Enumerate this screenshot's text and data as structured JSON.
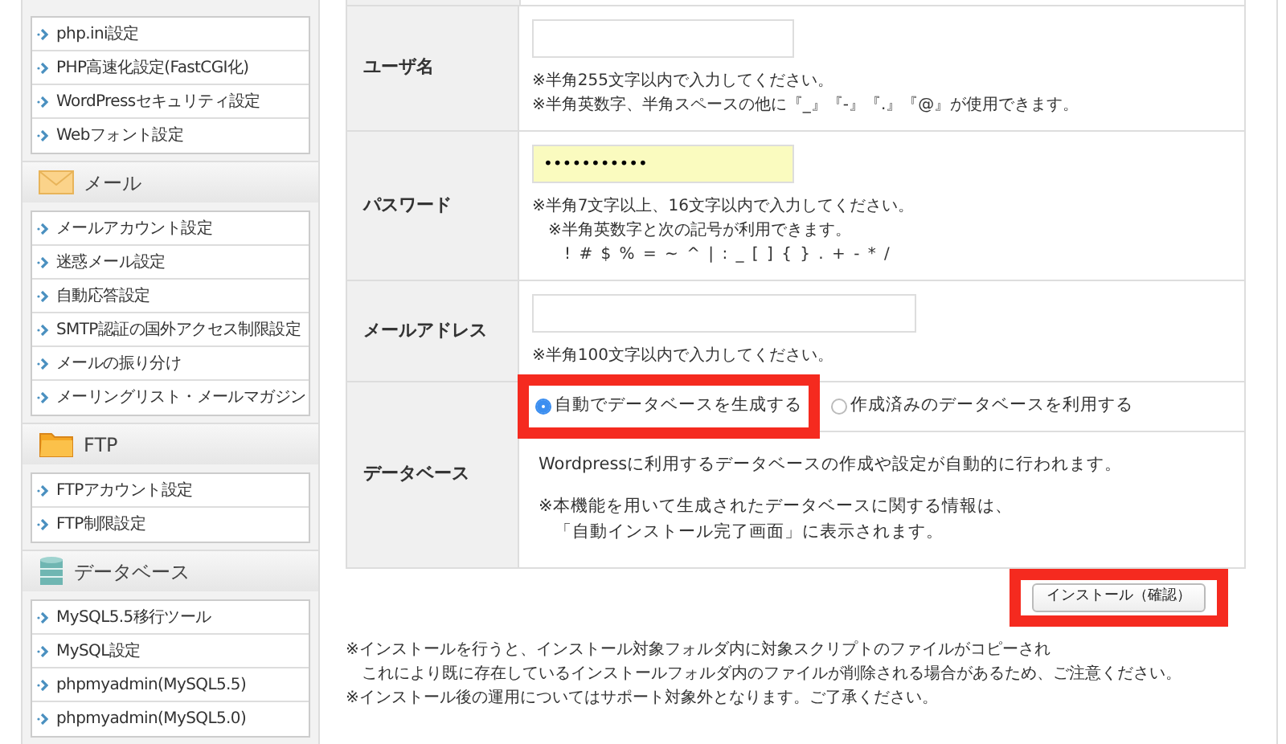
{
  "sidebar": {
    "groups": [
      {
        "items": [
          "php.ini設定",
          "PHP高速化設定(FastCGI化)",
          "WordPressセキュリティ設定",
          "Webフォント設定"
        ]
      },
      {
        "kind": "mail",
        "title": "メール",
        "items": [
          "メールアカウント設定",
          "迷惑メール設定",
          "自動応答設定",
          "SMTP認証の国外アクセス制限設定",
          "メールの振り分け",
          "メーリングリスト・メールマガジン"
        ]
      },
      {
        "kind": "folder",
        "title": "FTP",
        "items": [
          "FTPアカウント設定",
          "FTP制限設定"
        ]
      },
      {
        "kind": "database",
        "title": "データベース",
        "items": [
          "MySQL5.5移行ツール",
          "MySQL設定",
          "phpmyadmin(MySQL5.5)",
          "phpmyadmin(MySQL5.0)"
        ]
      }
    ]
  },
  "form": {
    "rows": [
      {
        "kind": "text",
        "label": "ユーザ名",
        "value": "",
        "hints": [
          {
            "kind": "note",
            "text": "※半角255文字以内で入力してください。"
          },
          {
            "kind": "note",
            "text": "※半角英数字、半角スペースの他に『_』『-』『.』『@』が使用できます。"
          }
        ]
      },
      {
        "kind": "text",
        "label": "パスワード",
        "value": "•••••••••••",
        "autofilled": true,
        "hints": [
          {
            "kind": "note",
            "text": "※半角7文字以上、16文字以内で入力してください。"
          },
          {
            "kind": "sub",
            "text": "※半角英数字と次の記号が利用できます。"
          },
          {
            "kind": "symbols",
            "text": "! # $ % = ~ ^ | : _ [ ] { } . + - * /"
          }
        ]
      },
      {
        "kind": "text",
        "label": "メールアドレス",
        "value": "",
        "wide": true,
        "hints": [
          {
            "kind": "note",
            "text": "※半角100文字以内で入力してください。"
          }
        ]
      },
      {
        "kind": "choice",
        "label": "データベース",
        "options": [
          {
            "label": "自動でデータベースを生成する",
            "selected": true,
            "highlighted": true
          },
          {
            "label": "作成済みのデータベースを利用する",
            "selected": false
          }
        ],
        "description": [
          {
            "kind": "note",
            "text": "Wordpressに利用するデータベースの作成や設定が自動的に行われます。"
          },
          {
            "kind": "gap",
            "text": "※本機能を用いて生成されたデータベースに関する情報は、"
          },
          {
            "kind": "sub",
            "text": "「自動インストール完了画面」に表示されます。"
          }
        ]
      }
    ]
  },
  "install_button": {
    "label": "インストール（確認）",
    "highlighted": true
  },
  "notes": [
    {
      "kind": "note",
      "text": "※インストールを行うと、インストール対象フォルダ内に対象スクリプトのファイルがコピーされ"
    },
    {
      "kind": "sub",
      "text": "これにより既に存在しているインストールフォルダ内のファイルが削除される場合があるため、ご注意ください。"
    },
    {
      "kind": "note",
      "text": "※インストール後の運用についてはサポート対象外となります。ご了承ください。"
    }
  ]
}
